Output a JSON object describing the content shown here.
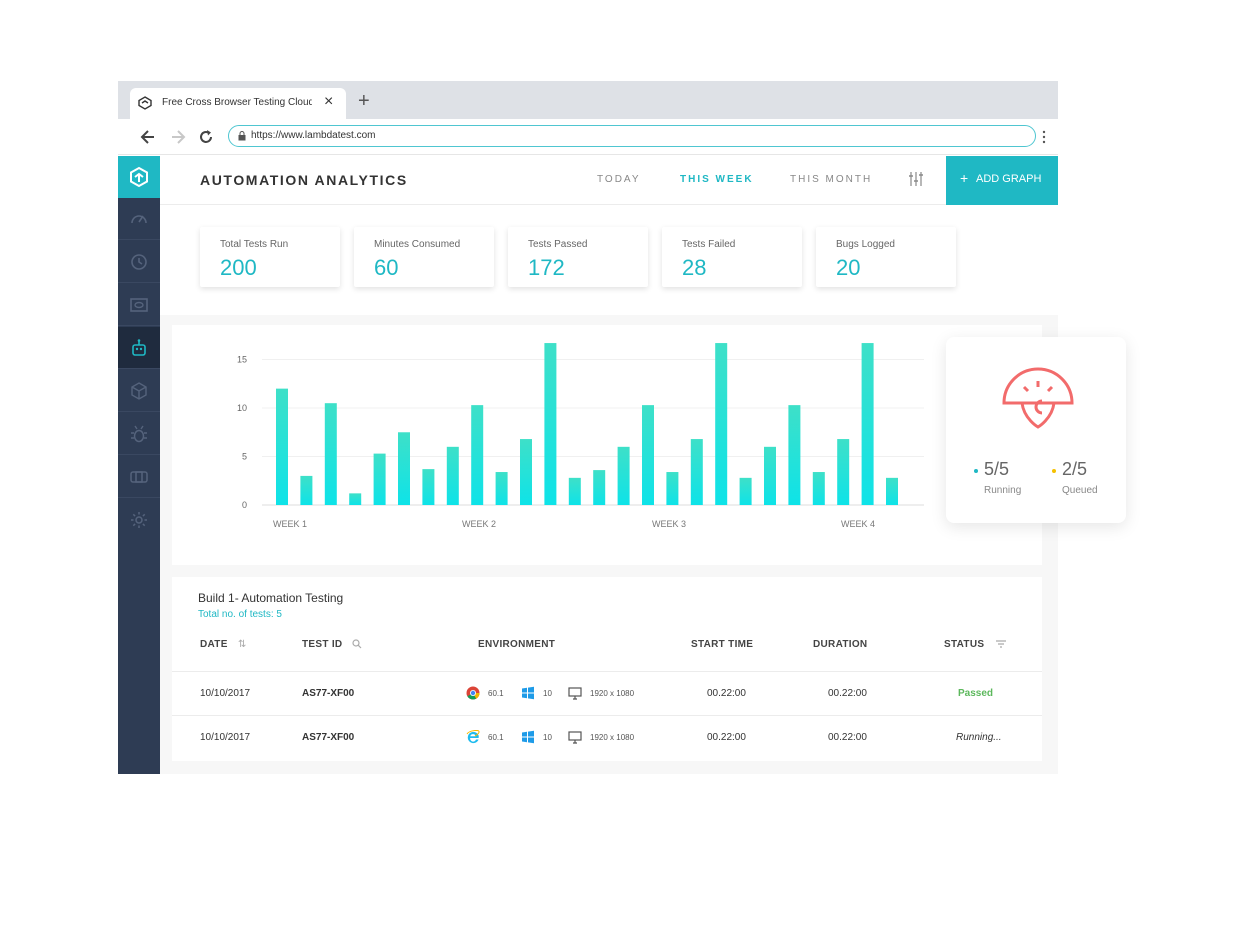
{
  "browser": {
    "tab_title": "Free Cross Browser Testing Cloud",
    "url": "https://www.lambdatest.com"
  },
  "header": {
    "title": "AUTOMATION ANALYTICS",
    "periods": [
      "TODAY",
      "THIS WEEK",
      "THIS MONTH"
    ],
    "active_period": "THIS WEEK",
    "add_graph_label": "ADD GRAPH"
  },
  "sidebar": {
    "items": [
      "dashboard-icon",
      "history-icon",
      "visual-icon",
      "automation-icon",
      "package-icon",
      "bug-icon",
      "integration-icon",
      "settings-icon"
    ],
    "active": "automation-icon"
  },
  "stats": [
    {
      "label": "Total Tests Run",
      "value": "200"
    },
    {
      "label": "Minutes Consumed",
      "value": "60"
    },
    {
      "label": "Tests Passed",
      "value": "172"
    },
    {
      "label": "Tests Failed",
      "value": "28"
    },
    {
      "label": "Bugs Logged",
      "value": "20"
    }
  ],
  "chart_data": {
    "type": "bar",
    "categories": [
      "WEEK 1",
      "WEEK 2",
      "WEEK 3",
      "WEEK 4"
    ],
    "yticks": [
      0,
      5,
      10,
      15
    ],
    "ylim": [
      0,
      16.5
    ],
    "values": [
      12,
      3,
      10.5,
      1.2,
      5.3,
      7.5,
      3.7,
      6,
      10.3,
      3.4,
      6.8,
      16.7,
      2.8,
      3.6,
      6,
      10.3,
      3.4,
      6.8,
      16.7,
      2.8,
      6,
      10.3,
      3.4,
      6.8,
      16.7,
      2.8
    ],
    "color": "#16e0d6"
  },
  "status": {
    "running_value": "5/5",
    "running_label": "Running",
    "queued_value": "2/5",
    "queued_label": "Queued",
    "running_color": "#1fb8c4",
    "queued_color": "#f5c100"
  },
  "table": {
    "title": "Build 1- Automation Testing",
    "subtitle": "Total no. of tests: 5",
    "headers": {
      "date": "DATE",
      "test_id": "TEST ID",
      "environment": "ENVIRONMENT",
      "start_time": "START TIME",
      "duration": "DURATION",
      "status": "STATUS"
    },
    "rows": [
      {
        "date": "10/10/2017",
        "test_id": "AS77-XF00",
        "browser_icon": "chrome-icon",
        "browser_version": "60.1",
        "os_icon": "windows-icon",
        "os_version": "10",
        "resolution": "1920 x 1080",
        "start_time": "00.22:00",
        "duration": "00.22:00",
        "status": "Passed"
      },
      {
        "date": "10/10/2017",
        "test_id": "AS77-XF00",
        "browser_icon": "ie-icon",
        "browser_version": "60.1",
        "os_icon": "windows-icon",
        "os_version": "10",
        "resolution": "1920 x 1080",
        "start_time": "00.22:00",
        "duration": "00.22:00",
        "status": "Running..."
      }
    ]
  }
}
